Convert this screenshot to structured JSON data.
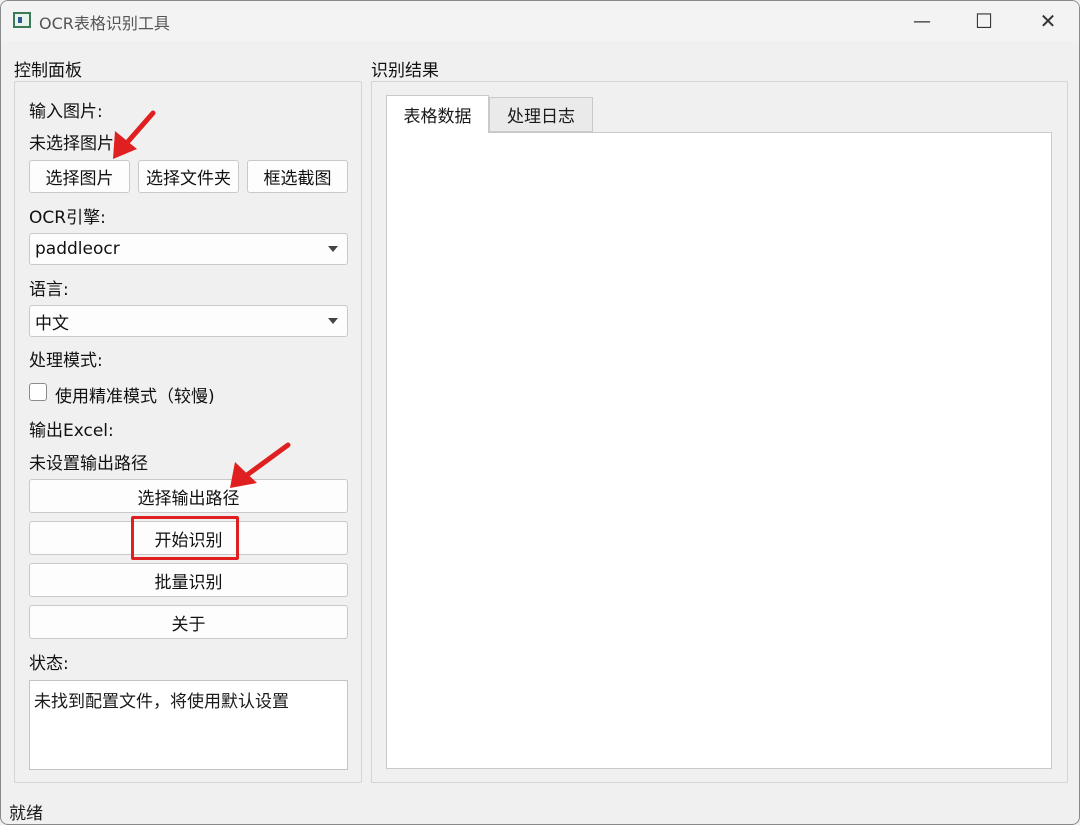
{
  "window": {
    "title": "OCR表格识别工具",
    "controls": {
      "minimize": "—",
      "maximize": "☐",
      "close": "✕"
    }
  },
  "control_panel": {
    "title": "控制面板",
    "input_label": "输入图片:",
    "input_status": "未选择图片",
    "buttons": {
      "select_image": "选择图片",
      "select_folder": "选择文件夹",
      "crop_capture": "框选截图"
    },
    "engine_label": "OCR引擎:",
    "engine_value": "paddleocr",
    "language_label": "语言:",
    "language_value": "中文",
    "mode_label": "处理模式:",
    "precise_mode_label": "使用精准模式（较慢)",
    "precise_mode_checked": false,
    "excel_label": "输出Excel:",
    "excel_status": "未设置输出路径",
    "select_output_button": "选择输出路径",
    "start_button": "开始识别",
    "batch_button": "批量识别",
    "about_button": "关于",
    "status_label": "状态:",
    "status_text": "未找到配置文件，将使用默认设置"
  },
  "results_panel": {
    "title": "识别结果",
    "tabs": [
      {
        "label": "表格数据",
        "active": true
      },
      {
        "label": "处理日志",
        "active": false
      }
    ]
  },
  "statusbar": {
    "text": "就绪"
  },
  "colors": {
    "annotation_red": "#e02020"
  }
}
